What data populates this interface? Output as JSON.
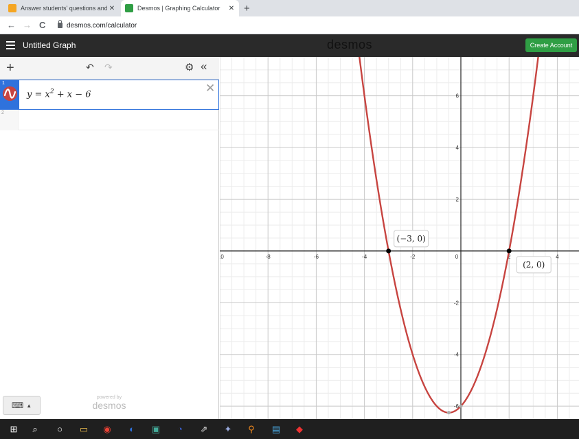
{
  "browser": {
    "tabs": [
      {
        "title": "Answer students' questions and e",
        "close": "✕"
      },
      {
        "title": "Desmos | Graphing Calculator",
        "close": "✕"
      }
    ],
    "new_tab": "+",
    "back": "←",
    "forward": "→",
    "reload": "C",
    "url": "desmos.com/calculator"
  },
  "header": {
    "menu_icon": "hamburger-icon",
    "title": "Untitled Graph",
    "logo": "desmos",
    "create_account": "Create Account"
  },
  "panel": {
    "add": "+",
    "undo": "↶",
    "redo": "↷",
    "settings": "⚙",
    "collapse": "«",
    "expressions": [
      {
        "index": "1",
        "lhs": "y",
        "eq": " = ",
        "x": "x",
        "exp": "2",
        "rest": " + x − 6",
        "color": "#c74440",
        "delete": "✕"
      },
      {
        "index": "2"
      }
    ],
    "keyboard_icon": "⌨",
    "keyboard_arrow": "▲",
    "powered_by": "powered by",
    "powered_logo": "desmos"
  },
  "graph": {
    "x_ticks": [
      "-10",
      "-8",
      "-6",
      "-4",
      "-2",
      "0",
      "2",
      "4"
    ],
    "y_ticks": [
      "6",
      "4",
      "2",
      "-2",
      "-4",
      "-6"
    ],
    "point_labels": [
      "(−3, 0)",
      "(2, 0)"
    ],
    "curve_color": "#c74440"
  },
  "chart_data": {
    "type": "line",
    "function": "y = x^2 + x - 6",
    "xlim": [
      -10,
      4.9
    ],
    "ylim": [
      -6.5,
      7.5
    ],
    "grid": true,
    "points": [
      {
        "x": -3,
        "y": 0,
        "label": "(−3, 0)"
      },
      {
        "x": 2,
        "y": 0,
        "label": "(2, 0)"
      },
      {
        "x": -0.5,
        "y": -6.25
      },
      {
        "x": 0,
        "y": -6
      }
    ]
  },
  "taskbar": {
    "items": [
      "⊞",
      "⌕",
      "○",
      "▭",
      "◉",
      "◐",
      "▣",
      "◔",
      "⇗",
      "✦",
      "⚲",
      "▤",
      "◆"
    ]
  }
}
